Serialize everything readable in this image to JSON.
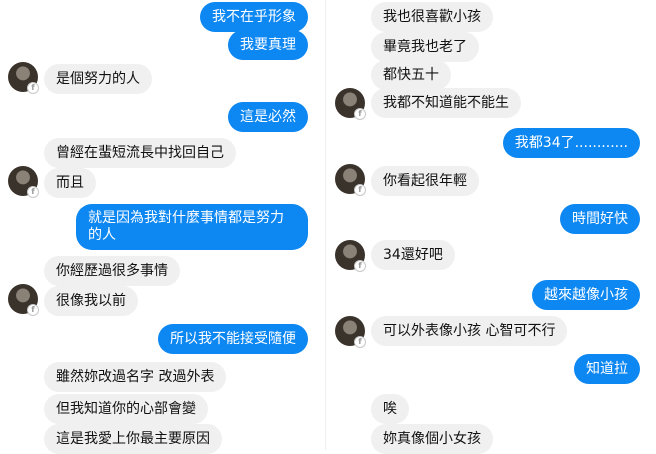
{
  "left_column": {
    "messages": [
      {
        "dir": "out",
        "text": "我不在乎形象"
      },
      {
        "dir": "out",
        "text": "我要真理"
      },
      {
        "dir": "in",
        "text": "是個努力的人"
      },
      {
        "dir": "out",
        "text": "這是必然"
      },
      {
        "dir": "in",
        "text": "曾經在蜚短流長中找回自己"
      },
      {
        "dir": "in",
        "text": "而且"
      },
      {
        "dir": "out",
        "text": "就是因為我對什麼事情都是努力的人"
      },
      {
        "dir": "in",
        "text": "你經歷過很多事情"
      },
      {
        "dir": "in",
        "text": "很像我以前"
      },
      {
        "dir": "out",
        "text": "所以我不能接受隨便"
      },
      {
        "dir": "in",
        "text": "雖然妳改過名字  改過外表"
      },
      {
        "dir": "in",
        "text": "但我知道你的心部會變"
      },
      {
        "dir": "in",
        "text": "這是我愛上你最主要原因"
      }
    ]
  },
  "right_column": {
    "messages": [
      {
        "dir": "in",
        "text": "我也很喜歡小孩"
      },
      {
        "dir": "in",
        "text": "畢竟我也老了"
      },
      {
        "dir": "in",
        "text": "都快五十"
      },
      {
        "dir": "in",
        "text": "我都不知道能不能生"
      },
      {
        "dir": "out",
        "text": "我都34了............"
      },
      {
        "dir": "in",
        "text": "你看起很年輕"
      },
      {
        "dir": "out",
        "text": "時間好快"
      },
      {
        "dir": "in",
        "text": "34還好吧"
      },
      {
        "dir": "out",
        "text": "越來越像小孩"
      },
      {
        "dir": "in",
        "text": "可以外表像小孩  心智可不行"
      },
      {
        "dir": "out",
        "text": "知道拉"
      },
      {
        "dir": "in",
        "text": "唉"
      },
      {
        "dir": "in",
        "text": "妳真像個小女孩"
      }
    ]
  },
  "sender_badge_icon": "facebook-icon",
  "colors": {
    "outgoing": "#0d87f2",
    "incoming": "#f0f0f0"
  }
}
